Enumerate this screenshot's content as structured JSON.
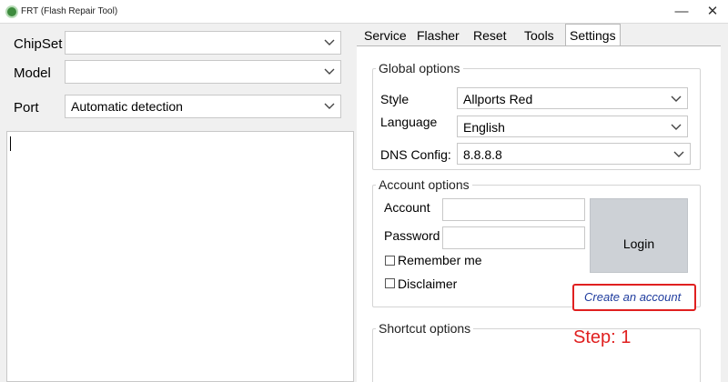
{
  "window": {
    "title": "FRT (Flash Repair Tool)",
    "minimize": "—",
    "close": "✕"
  },
  "left": {
    "chipset_label": "ChipSet",
    "chipset_value": "",
    "model_label": "Model",
    "model_value": "",
    "port_label": "Port",
    "port_value": "Automatic detection"
  },
  "tabs": [
    {
      "label": "Service"
    },
    {
      "label": "Flasher"
    },
    {
      "label": "Reset"
    },
    {
      "label": "Tools"
    },
    {
      "label": "Settings",
      "active": true
    }
  ],
  "settings": {
    "global": {
      "legend": "Global options",
      "style_label": "Style",
      "style_value": "Allports Red",
      "language_label": "Language",
      "language_value": "English",
      "dns_label": "DNS Config:",
      "dns_value": "8.8.8.8"
    },
    "account": {
      "legend": "Account options",
      "account_label": "Account",
      "account_value": "",
      "password_label": "Password",
      "password_value": "",
      "remember_label": "Remember me",
      "disclaimer_label": "Disclaimer",
      "login_label": "Login",
      "create_account_label": "Create an account"
    },
    "shortcut": {
      "legend": "Shortcut options"
    }
  },
  "annotation": {
    "step_text": "Step: 1",
    "color": "#e02020"
  },
  "icons": {
    "dropdown": "chevron-down-icon",
    "app": "frt-app-icon"
  }
}
